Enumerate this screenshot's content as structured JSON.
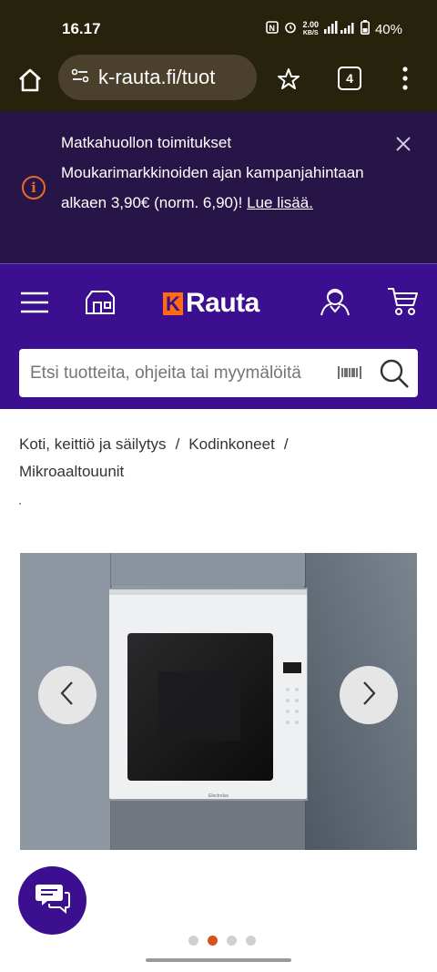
{
  "status_bar": {
    "time": "16.17",
    "net_speed_value": "2.00",
    "net_speed_unit": "KB/S",
    "battery": "40%"
  },
  "browser": {
    "url": "k-rauta.fi/tuot",
    "tab_count": "4"
  },
  "banner": {
    "line1": "Matkahuollon toimitukset",
    "line2": "Moukarimarkkinoiden ajan kampanjahintaan alkaen 3,90€ (norm. 6,90)!",
    "link": "Lue lisää."
  },
  "header": {
    "logo_mark": "K",
    "logo_text": "Rauta"
  },
  "search": {
    "placeholder": "Etsi tuotteita, ohjeita tai myymälöitä"
  },
  "breadcrumb": {
    "items": [
      "Koti, keittiö ja säilytys",
      "Kodinkoneet",
      "Mikroaaltouunit"
    ],
    "separator": "/"
  },
  "gallery": {
    "dots_total": 4,
    "active_index": 1,
    "appliance_brand": "Electrolux"
  },
  "colors": {
    "brand_purple": "#3b0f8f",
    "banner_purple": "#281548",
    "accent_orange": "#ff6a13",
    "browser_bar": "#27220c"
  }
}
